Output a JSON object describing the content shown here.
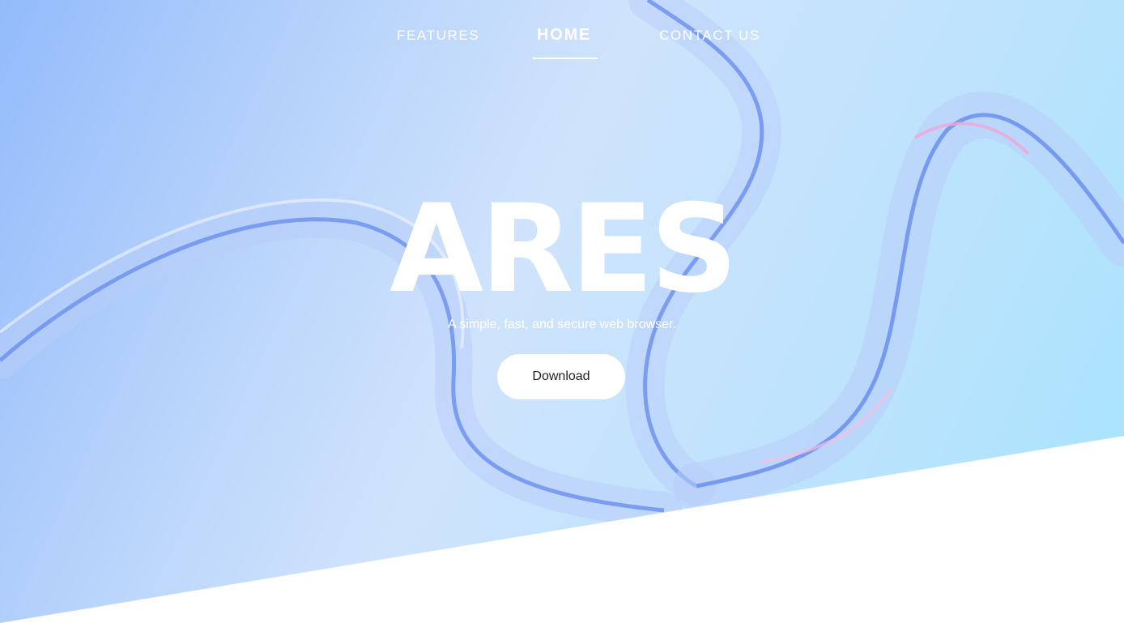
{
  "nav": {
    "items": [
      {
        "label": "FEATURES"
      },
      {
        "label": "HOME"
      },
      {
        "label": "CONTACT US"
      }
    ]
  },
  "hero": {
    "title": "ARES",
    "subtitle": "A simple, fast, and secure web browser.",
    "download_label": "Download"
  },
  "colors": {
    "background_start": "#93bbfb",
    "background_end": "#a6e3fd",
    "ribbon": "#6f93ee",
    "text": "#ffffff",
    "button_bg": "#ffffff",
    "button_text": "#222222"
  }
}
